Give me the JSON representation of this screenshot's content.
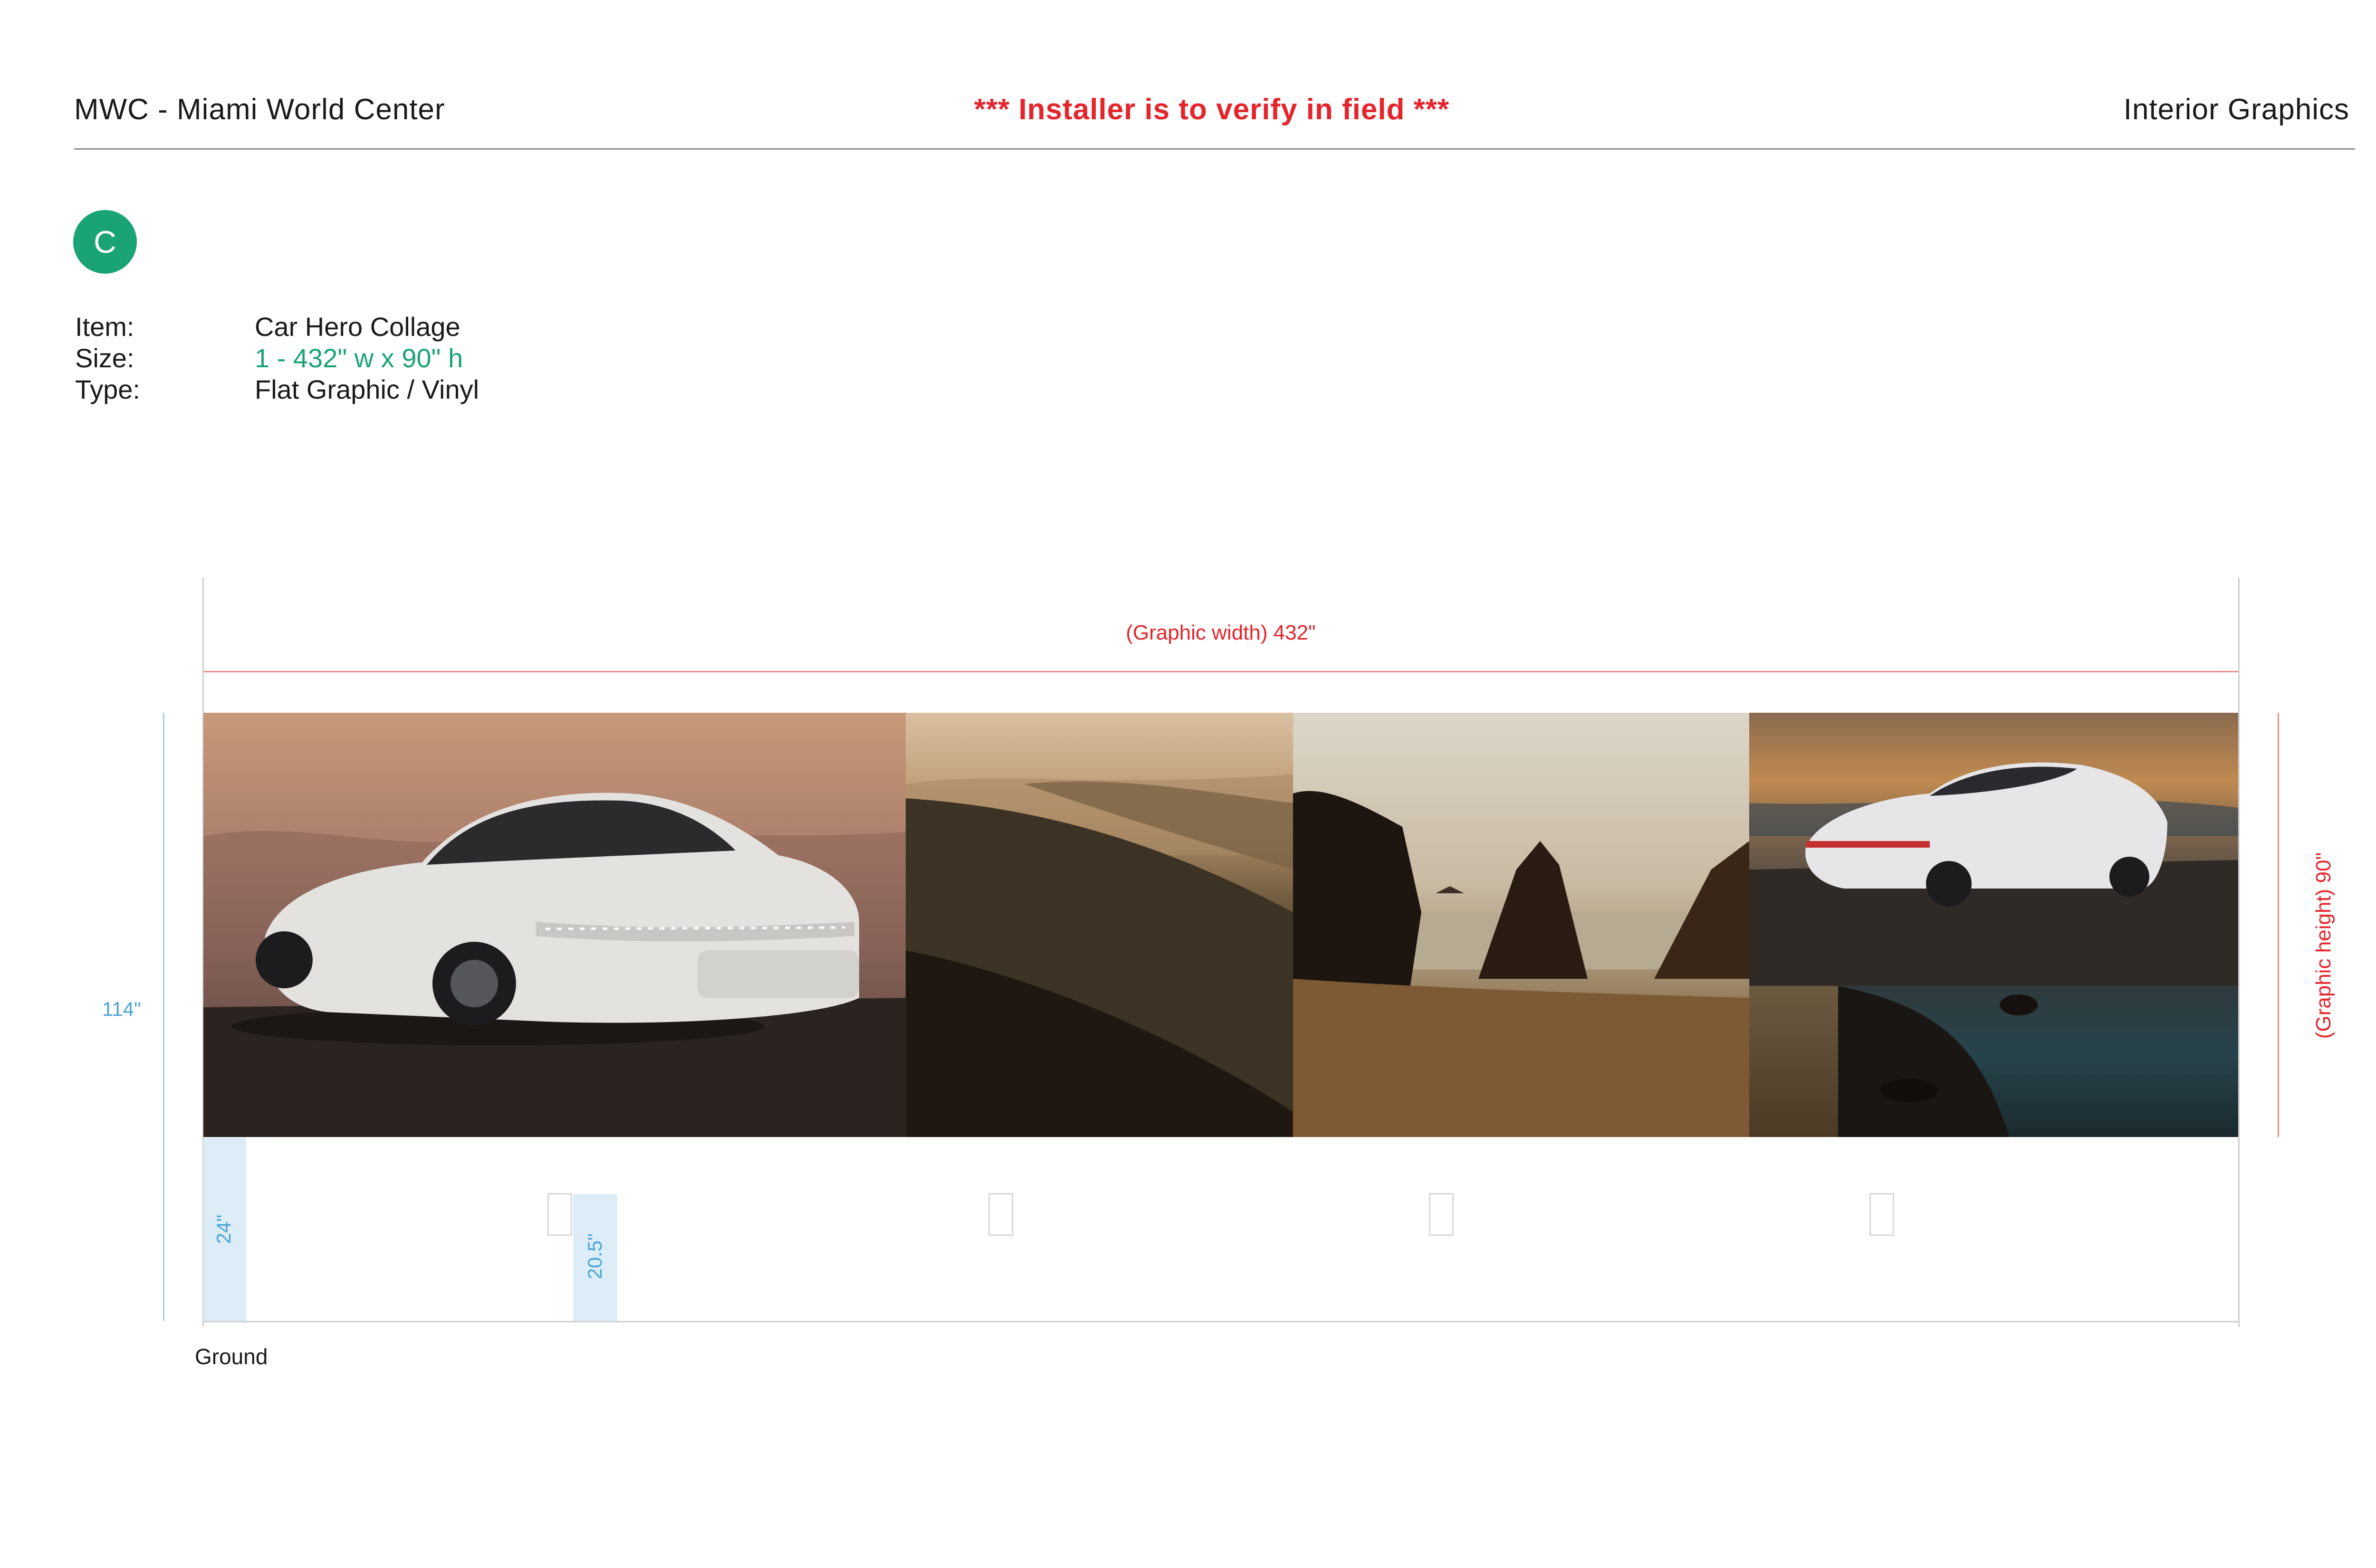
{
  "header": {
    "left": "MWC - Miami World Center",
    "center": "*** Installer is to verify in field ***",
    "right": "Interior Graphics"
  },
  "badge": {
    "letter": "C",
    "color": "#1aa374"
  },
  "info": {
    "item_label": "Item:",
    "item_value": "Car Hero Collage",
    "size_label": "Size:",
    "size_value": "1 - 432\" w x 90\" h",
    "type_label": "Type:",
    "type_value": "Flat Graphic / Vinyl"
  },
  "dimensions": {
    "graphic_width": "(Graphic width) 432\"",
    "graphic_height": "(Graphic height) 90\"",
    "wall_height": "114\"",
    "block_1": "24\"",
    "block_2": "20.5\"",
    "ground": "Ground"
  },
  "collage": {
    "panels": [
      "front-car-photo",
      "hills-photo",
      "coast-rocks-photo",
      "rear-car-photo",
      "shore-water-photo"
    ]
  },
  "colors": {
    "accent_red": "#e5242b",
    "accent_green": "#1aa374",
    "dimension_blue": "#4aa3d6"
  }
}
